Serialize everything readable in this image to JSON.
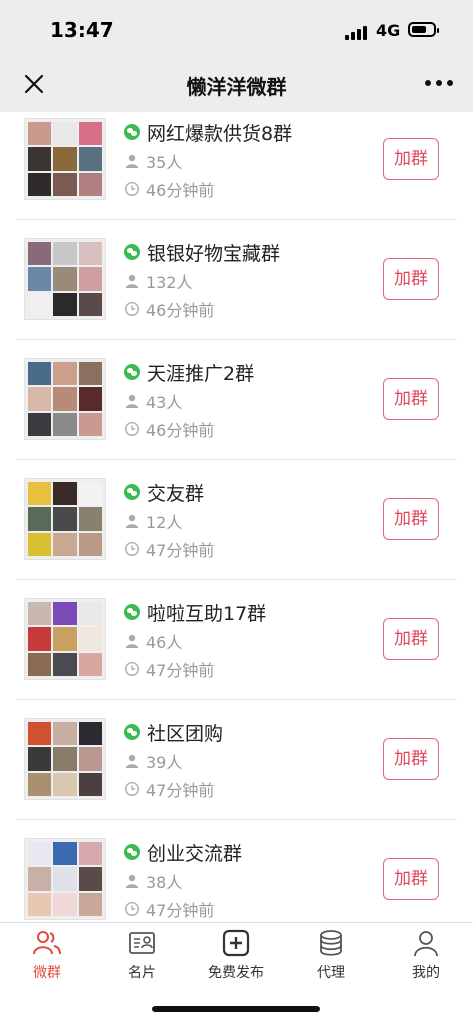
{
  "status_bar": {
    "time": "13:47",
    "network": "4G"
  },
  "nav": {
    "title": "懒洋洋微群",
    "close_icon": "close-icon",
    "more_icon": "more-dots-icon"
  },
  "groups": [
    {
      "name": "网红爆款供货8群",
      "members": "35人",
      "time": "46分钟前",
      "join_label": "加群"
    },
    {
      "name": "银银好物宝藏群",
      "members": "132人",
      "time": "46分钟前",
      "join_label": "加群"
    },
    {
      "name": "天涯推广2群",
      "members": "43人",
      "time": "46分钟前",
      "join_label": "加群"
    },
    {
      "name": " 交友群",
      "members": "12人",
      "time": "47分钟前",
      "join_label": "加群"
    },
    {
      "name": "啦啦互助17群",
      "members": "46人",
      "time": "47分钟前",
      "join_label": "加群"
    },
    {
      "name": "社区团购",
      "members": "39人",
      "time": "47分钟前",
      "join_label": "加群"
    },
    {
      "name": "创业交流群",
      "members": "38人",
      "time": "47分钟前",
      "join_label": "加群"
    }
  ],
  "tabs": [
    {
      "label": "微群",
      "icon": "group-icon",
      "active": true
    },
    {
      "label": "名片",
      "icon": "card-icon",
      "active": false
    },
    {
      "label": "免费发布",
      "icon": "plus-square-icon",
      "active": false
    },
    {
      "label": "代理",
      "icon": "database-icon",
      "active": false
    },
    {
      "label": "我的",
      "icon": "person-icon",
      "active": false
    }
  ],
  "colors": {
    "accent": "#e04a3f",
    "wechat_green": "#3dbb4f",
    "join_border": "#e06a7a"
  }
}
